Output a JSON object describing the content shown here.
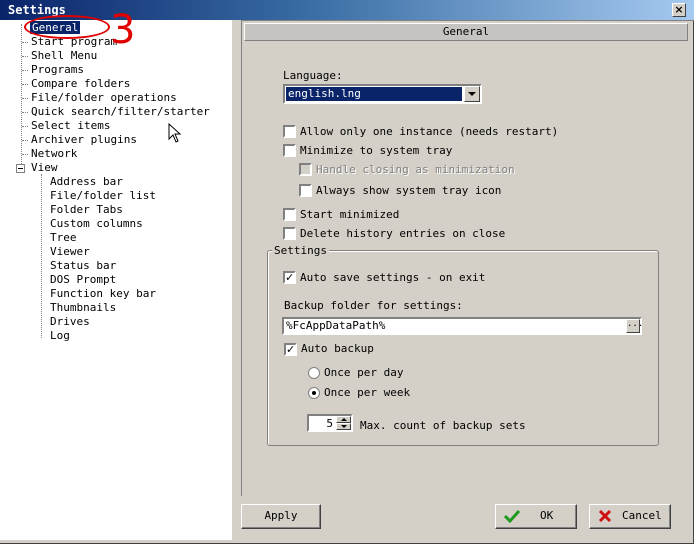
{
  "window": {
    "title": "Settings",
    "close_glyph": "×"
  },
  "annotation": {
    "number": "3",
    "color": "#e00000"
  },
  "tree": {
    "expander_state": "expanded",
    "items": [
      {
        "label": "General",
        "selected": true
      },
      {
        "label": "Start program"
      },
      {
        "label": "Shell Menu"
      },
      {
        "label": "Programs"
      },
      {
        "label": "Compare folders"
      },
      {
        "label": "File/folder operations"
      },
      {
        "label": "Quick search/filter/starter"
      },
      {
        "label": "Select items"
      },
      {
        "label": "Archiver plugins"
      },
      {
        "label": "Network"
      },
      {
        "label": "View"
      }
    ],
    "view_children": [
      "Address bar",
      "File/folder list",
      "Folder Tabs",
      "Custom columns",
      "Tree",
      "Viewer",
      "Status bar",
      "DOS Prompt",
      "Function key bar",
      "Thumbnails",
      "Drives",
      "Log"
    ]
  },
  "panel": {
    "header": "General",
    "language_label": "Language:",
    "language_value": "english.lng",
    "options": {
      "single_instance": {
        "label": "Allow only one instance (needs restart)",
        "checked": false
      },
      "minimize_to_tray": {
        "label": "Minimize to system tray",
        "checked": false
      },
      "handle_closing": {
        "label": "Handle closing as minimization",
        "checked": false,
        "disabled": true
      },
      "always_tray_icon": {
        "label": "Always show system tray icon",
        "checked": false
      },
      "start_minimized": {
        "label": "Start minimized",
        "checked": false
      },
      "delete_history": {
        "label": "Delete history entries on close",
        "checked": false
      }
    },
    "settings_group": {
      "legend": "Settings",
      "auto_save": {
        "label": "Auto save settings - on exit",
        "checked": true
      },
      "backup_folder_label": "Backup folder for settings:",
      "backup_folder_value": "%FcAppDataPath%",
      "browse_label": "...",
      "auto_backup": {
        "label": "Auto backup",
        "checked": true
      },
      "once_per_day": {
        "label": "Once per day",
        "selected": false
      },
      "once_per_week": {
        "label": "Once per week",
        "selected": true
      },
      "max_backups_value": "5",
      "max_backups_label": "Max. count of backup sets"
    }
  },
  "buttons": {
    "apply": "Apply",
    "ok": "OK",
    "cancel": "Cancel"
  },
  "colors": {
    "ok_check": "#1f9a1f",
    "cancel_x": "#d01010",
    "selection": "#0a246a"
  }
}
